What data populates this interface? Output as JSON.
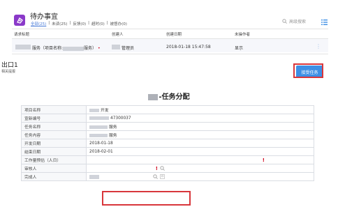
{
  "header": {
    "title": "待办事宜",
    "tabs": [
      {
        "label": "全部(25)",
        "active": true
      },
      {
        "label": "未读(25)"
      },
      {
        "label": "反馈(0)"
      },
      {
        "label": "超时(0)"
      },
      {
        "label": "被督办(0)"
      }
    ],
    "search_label": "高级搜索"
  },
  "list": {
    "columns": [
      "请求标题",
      "创建人",
      "创建日期",
      "未操作者"
    ],
    "row": {
      "title_prefix": "服务（项目名称:",
      "title_suffix": "服务）",
      "creator": "管理员",
      "date": "2018-01-18 15:47:58",
      "pending": "显示"
    }
  },
  "section": {
    "title": "出口1",
    "subtitle": "相关提报"
  },
  "accept_button": "接受任务",
  "form": {
    "title": "-任务分配",
    "rows": [
      {
        "label": "项目名称",
        "value": "开发"
      },
      {
        "label": "宣新编号",
        "value": "47300037"
      },
      {
        "label": "任务名称",
        "value": "服务"
      },
      {
        "label": "任务内容",
        "value": "服务"
      },
      {
        "label": "开发日期",
        "value": "2018-01-18"
      },
      {
        "label": "结束日期",
        "value": "2018-02-01"
      },
      {
        "label": "工作量预估（人日）",
        "value": ""
      },
      {
        "label": "审核人",
        "value": ""
      },
      {
        "label": "完成人",
        "value": ""
      }
    ]
  },
  "colors": {
    "accent": "#3d8fe5",
    "brand": "#8a39c9",
    "highlight": "#d8363b"
  }
}
